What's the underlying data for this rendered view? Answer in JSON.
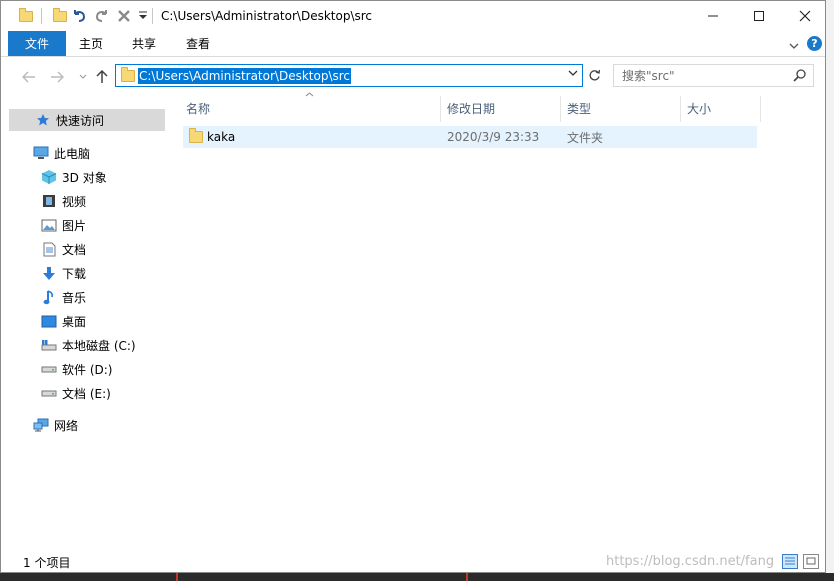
{
  "window": {
    "title": "C:\\Users\\Administrator\\Desktop\\src"
  },
  "ribbon": {
    "tabs": [
      "文件",
      "主页",
      "共享",
      "查看"
    ]
  },
  "address": {
    "path": "C:\\Users\\Administrator\\Desktop\\src"
  },
  "search": {
    "placeholder": "搜索\"src\""
  },
  "nav": {
    "quick_access": "快速访问",
    "this_pc": "此电脑",
    "items": [
      "3D 对象",
      "视频",
      "图片",
      "文档",
      "下载",
      "音乐",
      "桌面",
      "本地磁盘 (C:)",
      "软件 (D:)",
      "文档 (E:)"
    ],
    "network": "网络"
  },
  "columns": {
    "name": "名称",
    "date": "修改日期",
    "type": "类型",
    "size": "大小"
  },
  "files": [
    {
      "name": "kaka",
      "date": "2020/3/9 23:33",
      "type": "文件夹",
      "size": ""
    }
  ],
  "status": {
    "count": "1 个项目"
  },
  "watermark": "https://blog.csdn.net/fang",
  "colors": {
    "accent": "#0078d7",
    "ribbon_file": "#1979ca",
    "selection": "#e5f3ff",
    "folder": "#f8d775"
  }
}
